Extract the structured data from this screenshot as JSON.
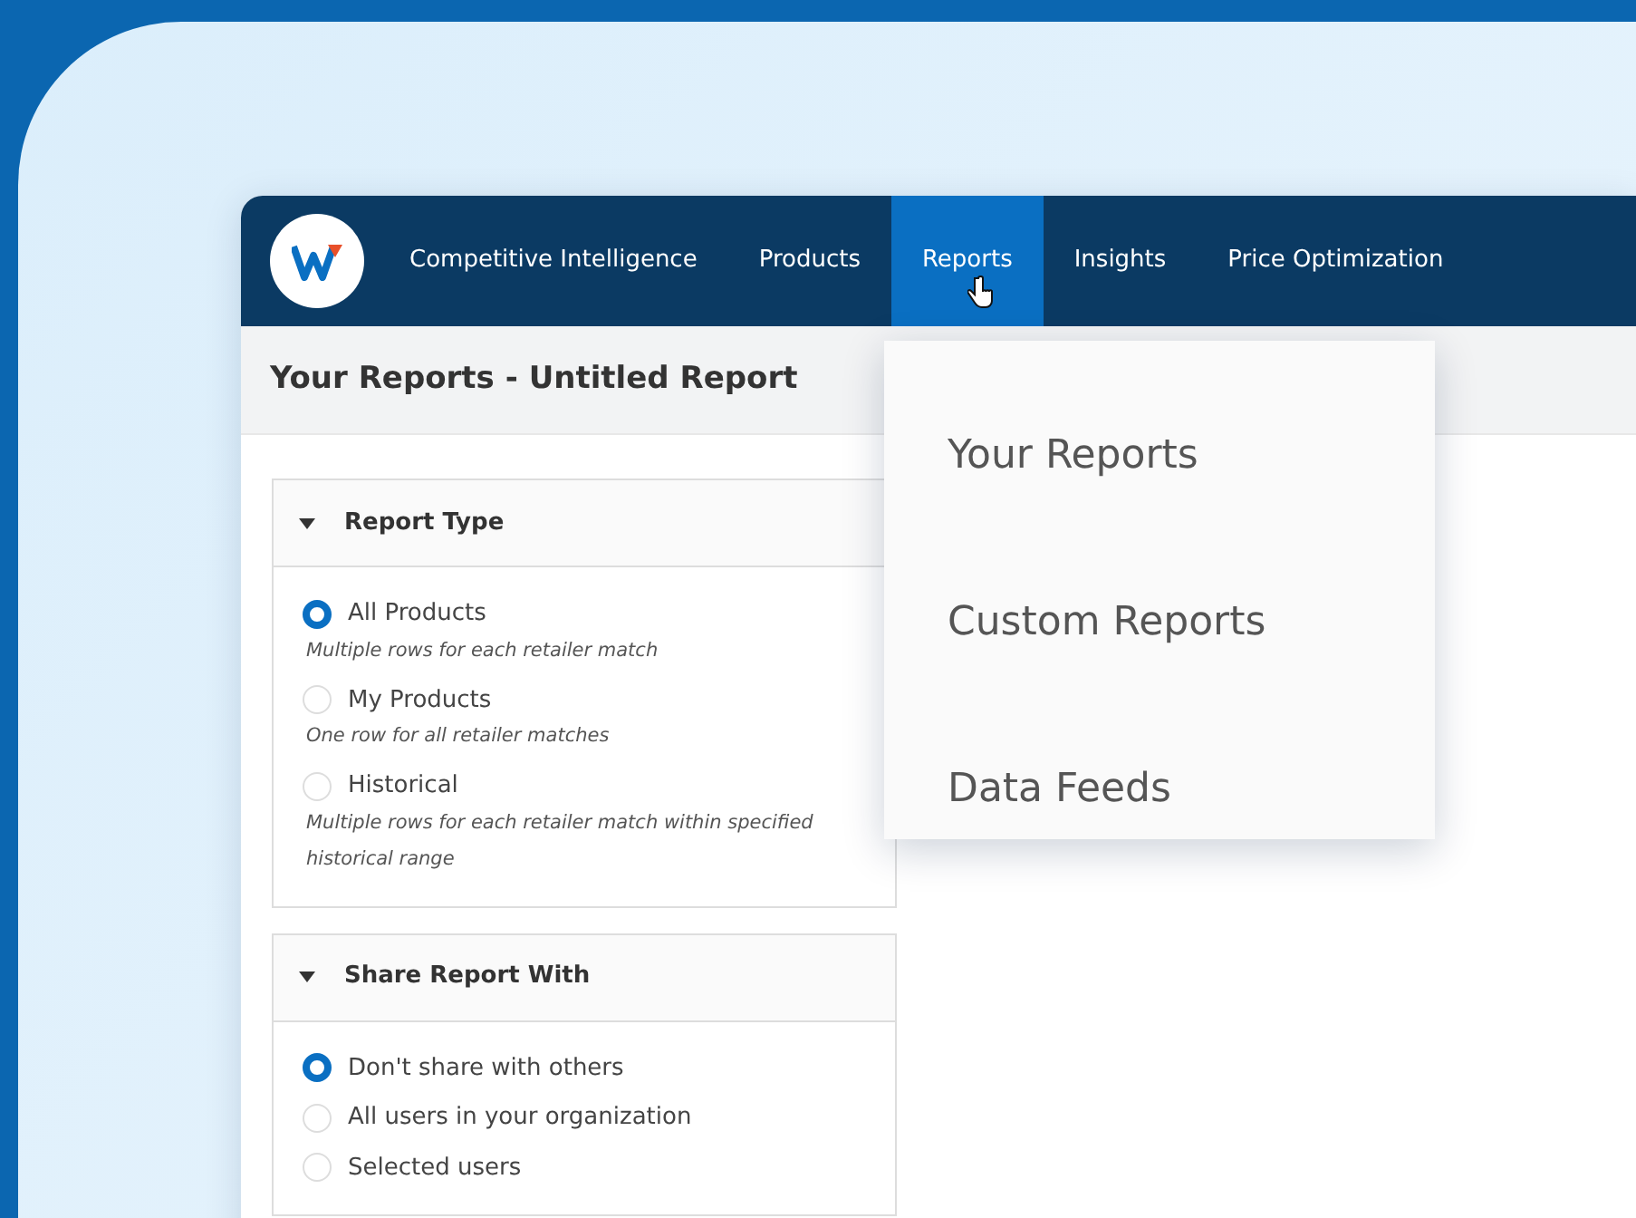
{
  "nav": {
    "items": [
      {
        "label": "Competitive Intelligence",
        "selected": false
      },
      {
        "label": "Products",
        "selected": false
      },
      {
        "label": "Reports",
        "selected": true
      },
      {
        "label": "Insights",
        "selected": false
      },
      {
        "label": "Price Optimization",
        "selected": false
      }
    ]
  },
  "dropdown": {
    "items": [
      "Your Reports",
      "Custom Reports",
      "Data Feeds"
    ]
  },
  "page_title": "Your Reports - Untitled Report",
  "sections": [
    {
      "title": "Report Type",
      "expanded": true,
      "options": [
        {
          "label": "All Products",
          "description": "Multiple rows for each retailer match",
          "selected": true
        },
        {
          "label": "My Products",
          "description": "One row for all retailer matches",
          "selected": false
        },
        {
          "label": "Historical",
          "description": "Multiple rows for each retailer match within specified historical range",
          "selected": false
        }
      ]
    },
    {
      "title": "Share Report With",
      "expanded": true,
      "options": [
        {
          "label": "Don't share with others",
          "selected": true
        },
        {
          "label": "All users in your organization",
          "selected": false
        },
        {
          "label": "Selected users",
          "selected": false
        }
      ]
    }
  ]
}
